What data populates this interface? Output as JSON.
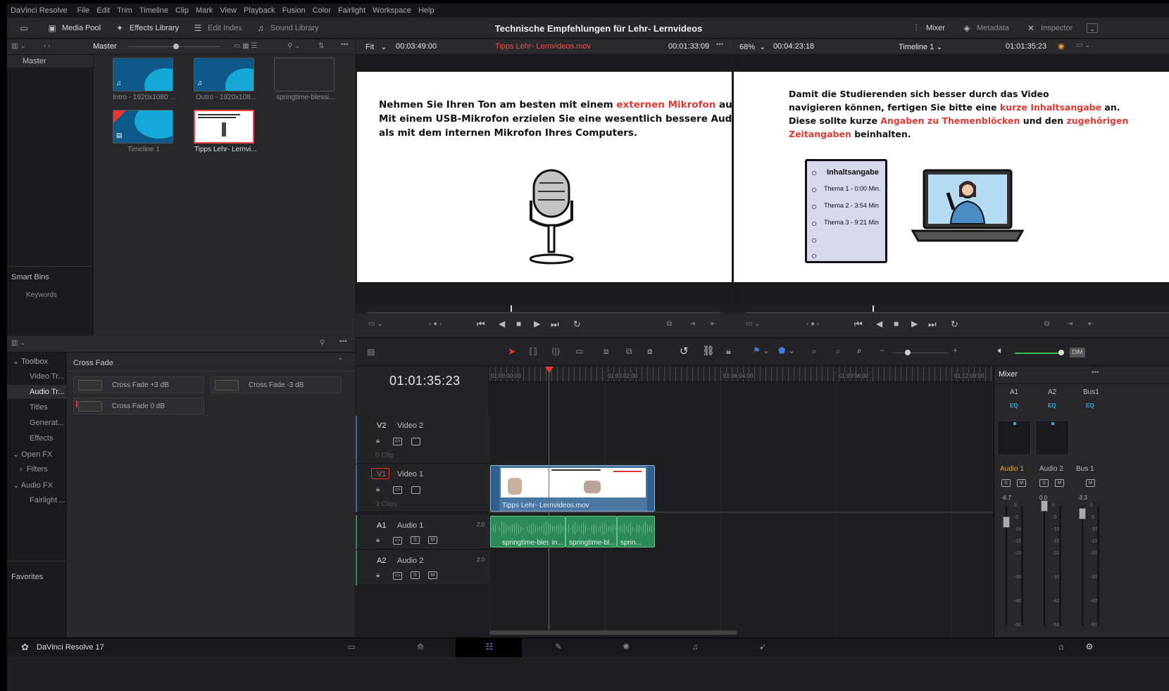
{
  "menu": [
    "DaVinci Resolve",
    "File",
    "Edit",
    "Trim",
    "Timeline",
    "Clip",
    "Mark",
    "View",
    "Playback",
    "Fusion",
    "Color",
    "Fairlight",
    "Workspace",
    "Help"
  ],
  "toolbar": {
    "media_pool": "Media Pool",
    "effects_library": "Effects Library",
    "edit_index": "Edit Index",
    "sound_library": "Sound Library",
    "project_title": "Technische Empfehlungen für Lehr- Lernvideos",
    "mixer": "Mixer",
    "metadata": "Metadata",
    "inspector": "Inspector"
  },
  "media_pool": {
    "bin_title": "Master",
    "bins": [
      "Master"
    ],
    "smart_bins": "Smart Bins",
    "keywords": "Keywords",
    "clips": [
      {
        "name": "Intro - 1920x1080 ..."
      },
      {
        "name": "Outro - 1920x108..."
      },
      {
        "name": "springtime-blessi..."
      },
      {
        "name": "Timeline 1"
      },
      {
        "name": "Tipps Lehr- Lernvi..."
      }
    ]
  },
  "source_viewer": {
    "fit": "Fit",
    "duration": "00:03:49:00",
    "clip_name": "Tipps Lehr- Lernvideos.mov",
    "timecode": "00:01:33:09",
    "slide": {
      "l1a": "Nehmen Sie Ihren Ton am besten mit einem ",
      "l1b": "externen Mikrofon",
      "l1c": " auf.",
      "l2": "Mit einem USB-Mikrofon erzielen Sie eine wesentlich bessere Audioqualität",
      "l3": "als mit dem internen Mikrofon Ihres Computers."
    }
  },
  "timeline_viewer": {
    "zoom": "68%",
    "duration": "00:04:23:18",
    "timeline": "Timeline 1",
    "timecode": "01:01:35:23",
    "slide": {
      "l1": "Damit die Studierenden sich besser durch das Video",
      "l2a": "navigieren können, fertigen Sie bitte eine ",
      "l2b": "kurze Inhaltsangabe",
      "l2c": " an.",
      "l3a": "Diese sollte kurze ",
      "l3b": "Angaben zu Themenblöcken",
      "l3c": " und den ",
      "l3d": "zugehörigen",
      "l4a": "Zeitangaben",
      "l4b": " beinhalten.",
      "toc_title": "Inhaltsangabe",
      "toc": [
        "Thema 1 - 0:00 Min.",
        "Thema 2 - 3:54 Min",
        "Thema 3 - 9:21 Min"
      ]
    }
  },
  "effects": {
    "tree": [
      "Toolbox",
      "Video Tr...",
      "Audio Tr...",
      "Titles",
      "Generat...",
      "Effects",
      "Open FX",
      "Filters",
      "Audio FX",
      "Fairlight ..."
    ],
    "favorites": "Favorites",
    "category": "Cross Fade",
    "items": [
      "Cross Fade +3 dB",
      "Cross Fade -3 dB",
      "Cross Fade 0 dB"
    ]
  },
  "timeline": {
    "timecode": "01:01:35:23",
    "ruler": [
      "01:00:00:00",
      "01:03:02:00",
      "01:06:04:00",
      "01:09:06:00",
      "01:12:08:00"
    ],
    "tracks": [
      {
        "id": "V2",
        "name": "Video 2",
        "info": "0 Clip"
      },
      {
        "id": "V1",
        "name": "Video 1",
        "info": "3 Clips"
      },
      {
        "id": "A1",
        "name": "Audio 1",
        "ch": "2.0"
      },
      {
        "id": "A2",
        "name": "Audio 2",
        "ch": "2.0"
      }
    ],
    "video_clip": "Tipps Lehr- Lernvideos.mov",
    "audio_clips": [
      "springtime-bles in...",
      "springtime-bl...",
      "sprin..."
    ],
    "s": "S",
    "m": "M"
  },
  "mixer": {
    "title": "Mixer",
    "channels": [
      "A1",
      "A2",
      "Bus1"
    ],
    "eq": "EQ",
    "names": [
      "Audio 1",
      "Audio 2",
      "Bus 1"
    ],
    "levels": [
      "-6.7",
      "0.0",
      "-3.3"
    ],
    "fader_levels_db": [
      -6.7,
      0.0,
      -3.3
    ],
    "scale": [
      "0",
      "-5",
      "-10",
      "-15",
      "-20",
      "-30",
      "-40",
      "-50"
    ],
    "dim": "DIM"
  },
  "status": {
    "app": "DaVinci Resolve 17"
  }
}
